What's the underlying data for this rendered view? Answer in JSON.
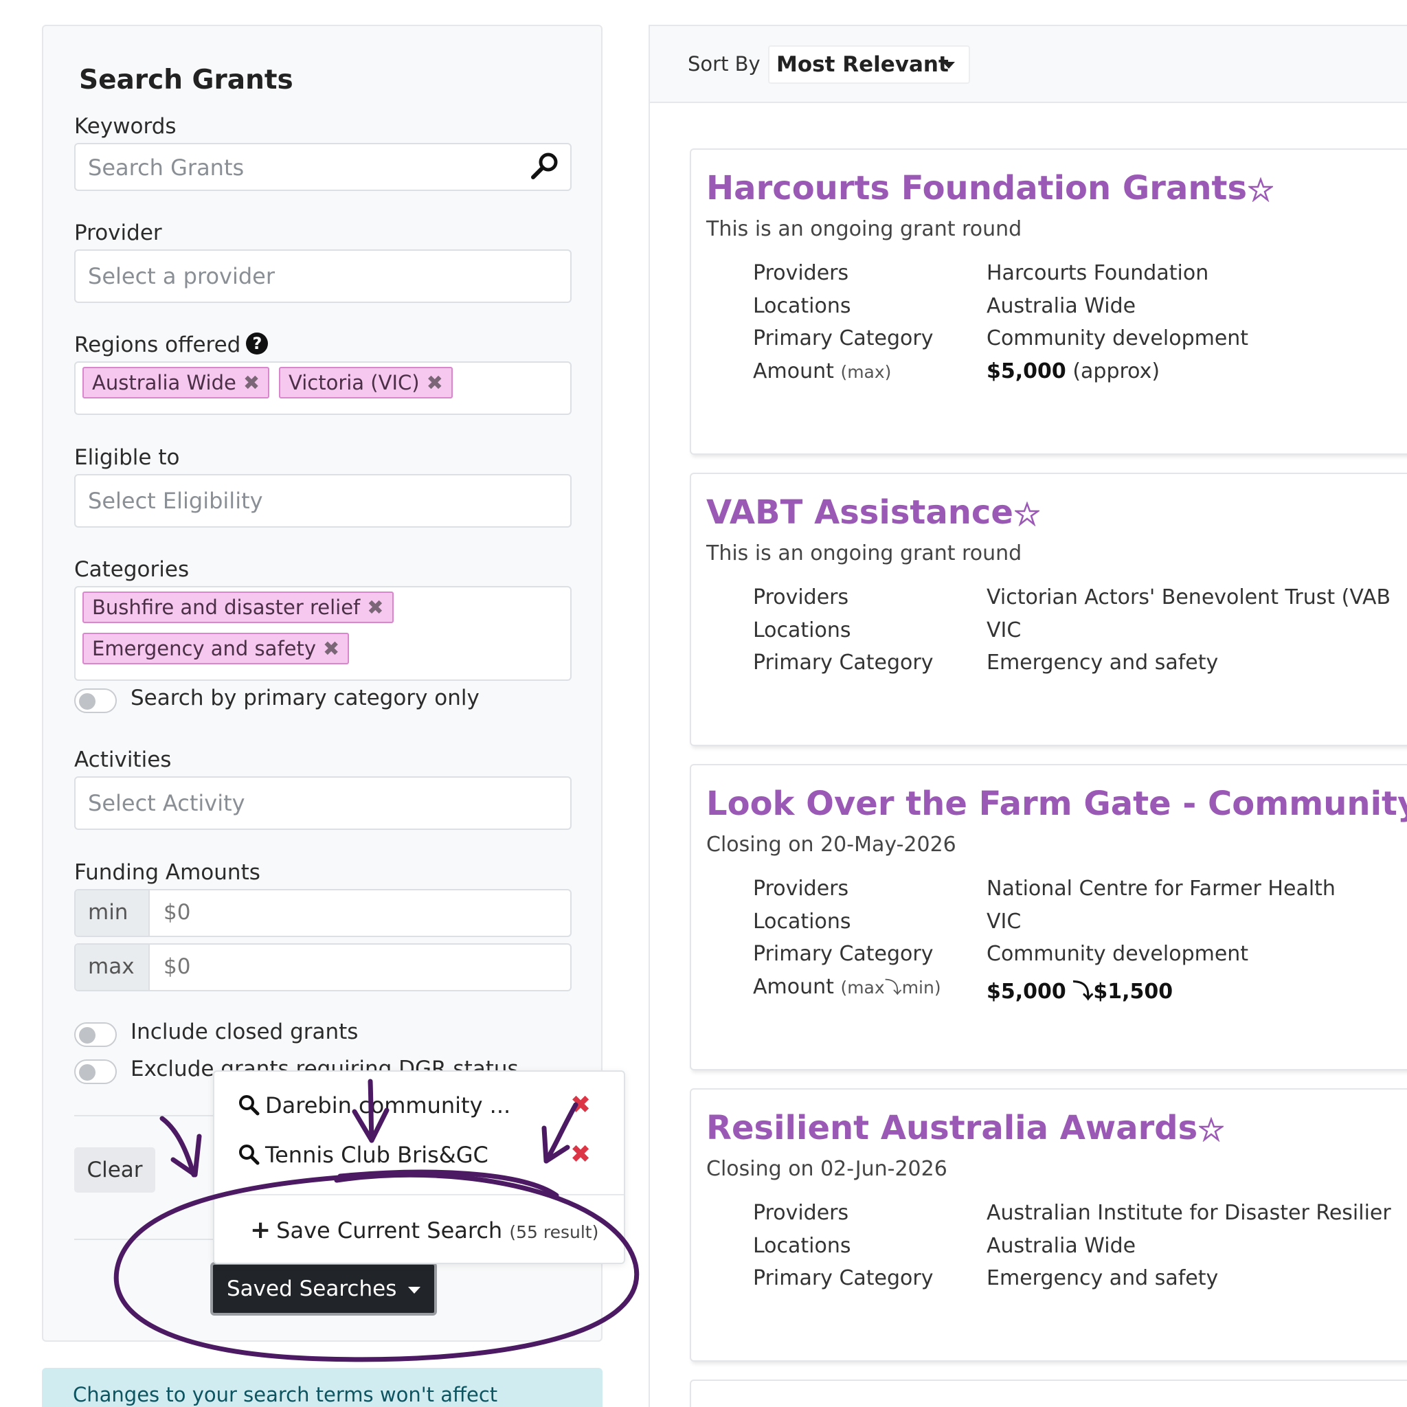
{
  "sidebar": {
    "title": "Search Grants",
    "keywords": {
      "label": "Keywords",
      "placeholder": "Search Grants"
    },
    "provider": {
      "label": "Provider",
      "placeholder": "Select a provider"
    },
    "regions": {
      "label": "Regions offered",
      "help_icon": "question-circle-icon",
      "chips": [
        "Australia Wide",
        "Victoria (VIC)"
      ]
    },
    "eligible": {
      "label": "Eligible to",
      "placeholder": "Select Eligibility"
    },
    "categories": {
      "label": "Categories",
      "chips": [
        "Bushfire and disaster relief",
        "Emergency and safety"
      ]
    },
    "primary_only_toggle": "Search by primary category only",
    "activities": {
      "label": "Activities",
      "placeholder": "Select Activity"
    },
    "funding": {
      "label": "Funding Amounts",
      "min_label": "min",
      "min_value": "$0",
      "max_label": "max",
      "max_value": "$0"
    },
    "include_closed_toggle": "Include closed grants",
    "exclude_dgr_toggle": "Exclude grants requiring DGR status",
    "clear_button": "Clear",
    "saved_searches_button": "Saved Searches",
    "chip_remove_symbol": "✖"
  },
  "alert": {
    "text": "Changes to your search terms won't affect"
  },
  "saved_dropdown": {
    "items": [
      "Darebin community ...",
      "Tennis Club Bris&GC"
    ],
    "remove_symbol": "✖",
    "save_label": "Save Current Search",
    "save_count": "(55 result)"
  },
  "sort": {
    "label": "Sort By",
    "value": "Most Relevant"
  },
  "results": [
    {
      "title": "Harcourts Foundation Grants",
      "subtitle": "This is an ongoing grant round",
      "providers_label": "Providers",
      "providers": "Harcourts Foundation",
      "locations_label": "Locations",
      "locations": "Australia Wide",
      "category_label": "Primary Category",
      "category": "Community development",
      "amount_label": "Amount",
      "amount_qualifier": "(max)",
      "amount": "$5,000",
      "amount_note": "(approx)"
    },
    {
      "title": "VABT Assistance",
      "subtitle": "This is an ongoing grant round",
      "providers_label": "Providers",
      "providers": "Victorian Actors' Benevolent Trust (VAB",
      "locations_label": "Locations",
      "locations": "VIC",
      "category_label": "Primary Category",
      "category": "Emergency and safety"
    },
    {
      "title": "Look Over the Farm Gate - Community G",
      "subtitle": "Closing on 20-May-2026",
      "providers_label": "Providers",
      "providers": "National Centre for Farmer Health",
      "locations_label": "Locations",
      "locations": "VIC",
      "category_label": "Primary Category",
      "category": "Community development",
      "amount_label": "Amount",
      "amount_qualifier_max": "(max",
      "amount_qualifier_min": "min)",
      "amount_max": "$5,000",
      "amount_min": "$1,500",
      "range_arrow": "⤵"
    },
    {
      "title": "Resilient Australia Awards",
      "subtitle": "Closing on 02-Jun-2026",
      "providers_label": "Providers",
      "providers": "Australian Institute for Disaster Resilier",
      "locations_label": "Locations",
      "locations": "Australia Wide",
      "category_label": "Primary Category",
      "category": "Emergency and safety"
    }
  ],
  "colors": {
    "title_purple": "#9b59b6",
    "chip_pink": "#f6c8ef",
    "annotation_purple": "#4b1a63",
    "remove_red": "#dc3545"
  }
}
